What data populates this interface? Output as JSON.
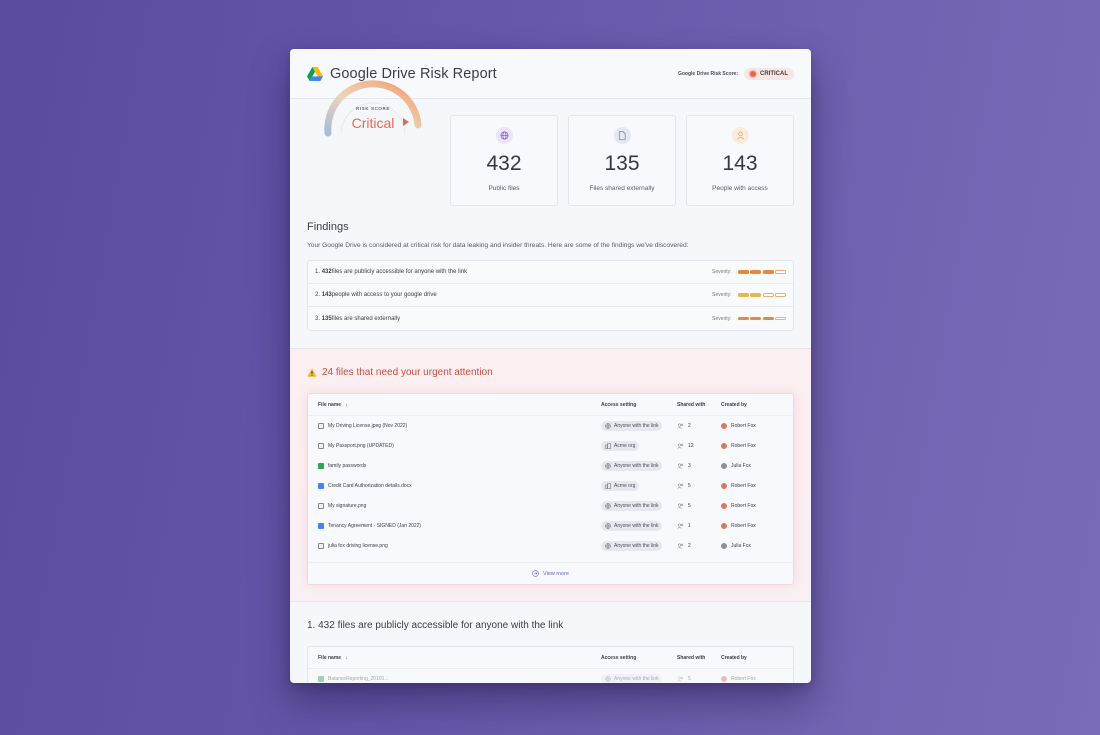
{
  "header": {
    "title": "Google Drive Risk Report",
    "risk_label": "Google Drive Risk Score:",
    "risk_badge": "CRITICAL"
  },
  "gauge": {
    "label": "RISK SCORE",
    "value": "Critical",
    "level": 0.85
  },
  "stats": [
    {
      "number": "432",
      "label": "Public files",
      "icon": "globe-icon"
    },
    {
      "number": "135",
      "label": "Files shared externally",
      "icon": "file-icon"
    },
    {
      "number": "143",
      "label": "People with access",
      "icon": "user-icon"
    }
  ],
  "findings": {
    "title": "Findings",
    "description": "Your Google Drive is considered at critical risk for data leaking and insider threats. Here are some of the findings we've discovered:",
    "severity_label": "Severity:",
    "items": [
      {
        "index": "1.",
        "count": "432",
        "text": " files are publicly accessible for anyone with the link",
        "severity": 3
      },
      {
        "index": "2.",
        "count": "143",
        "text": " people with access to your google drive",
        "severity": 2
      },
      {
        "index": "3.",
        "count": "135",
        "text": " files are shared externally",
        "severity": 3
      }
    ]
  },
  "urgent": {
    "title": "24 files that need your urgent attention",
    "columns": {
      "file": "File name",
      "access": "Access setting",
      "shared": "Shared with",
      "created": "Created by"
    },
    "rows": [
      {
        "name": "My Driving License.jpeg (Nov 2022)",
        "type": "image",
        "access": "Anyone with the link",
        "shared": "2",
        "owner": "Robert Fox"
      },
      {
        "name": "My Passport.png (UPDATED)",
        "type": "image",
        "access": "Acme org",
        "shared": "12",
        "owner": "Robert Fox"
      },
      {
        "name": "family passwords",
        "type": "sheet",
        "access": "Anyone with the link",
        "shared": "3",
        "owner": "Julia Fox"
      },
      {
        "name": "Credit Card Authorization details.docx",
        "type": "doc",
        "access": "Acme org",
        "shared": "5",
        "owner": "Robert Fox"
      },
      {
        "name": "My signature.png",
        "type": "image",
        "access": "Anyone with the link",
        "shared": "5",
        "owner": "Robert Fox"
      },
      {
        "name": "Tenancy Agreement - SIGNED (Jan 2022)",
        "type": "doc",
        "access": "Anyone with the link",
        "shared": "1",
        "owner": "Robert Fox"
      },
      {
        "name": "julia fox driving license.png",
        "type": "image",
        "access": "Anyone with the link",
        "shared": "2",
        "owner": "Julia Fox"
      }
    ],
    "view_more": "View more"
  },
  "section2": {
    "title": "1. 432 files are publicly accessible for anyone with the link",
    "columns": {
      "file": "File name",
      "access": "Access setting",
      "shared": "Shared with",
      "created": "Created by"
    },
    "rows": [
      {
        "name": "BalanceReporting_20191...",
        "type": "sheet",
        "access": "Anyone with the link",
        "shared": "5",
        "owner": "Robert Fox"
      }
    ]
  },
  "colors": {
    "critical": "#e06a55",
    "accent": "#5a6acb",
    "severity_high": "#e58a3d",
    "severity_mid": "#e8b84a"
  }
}
